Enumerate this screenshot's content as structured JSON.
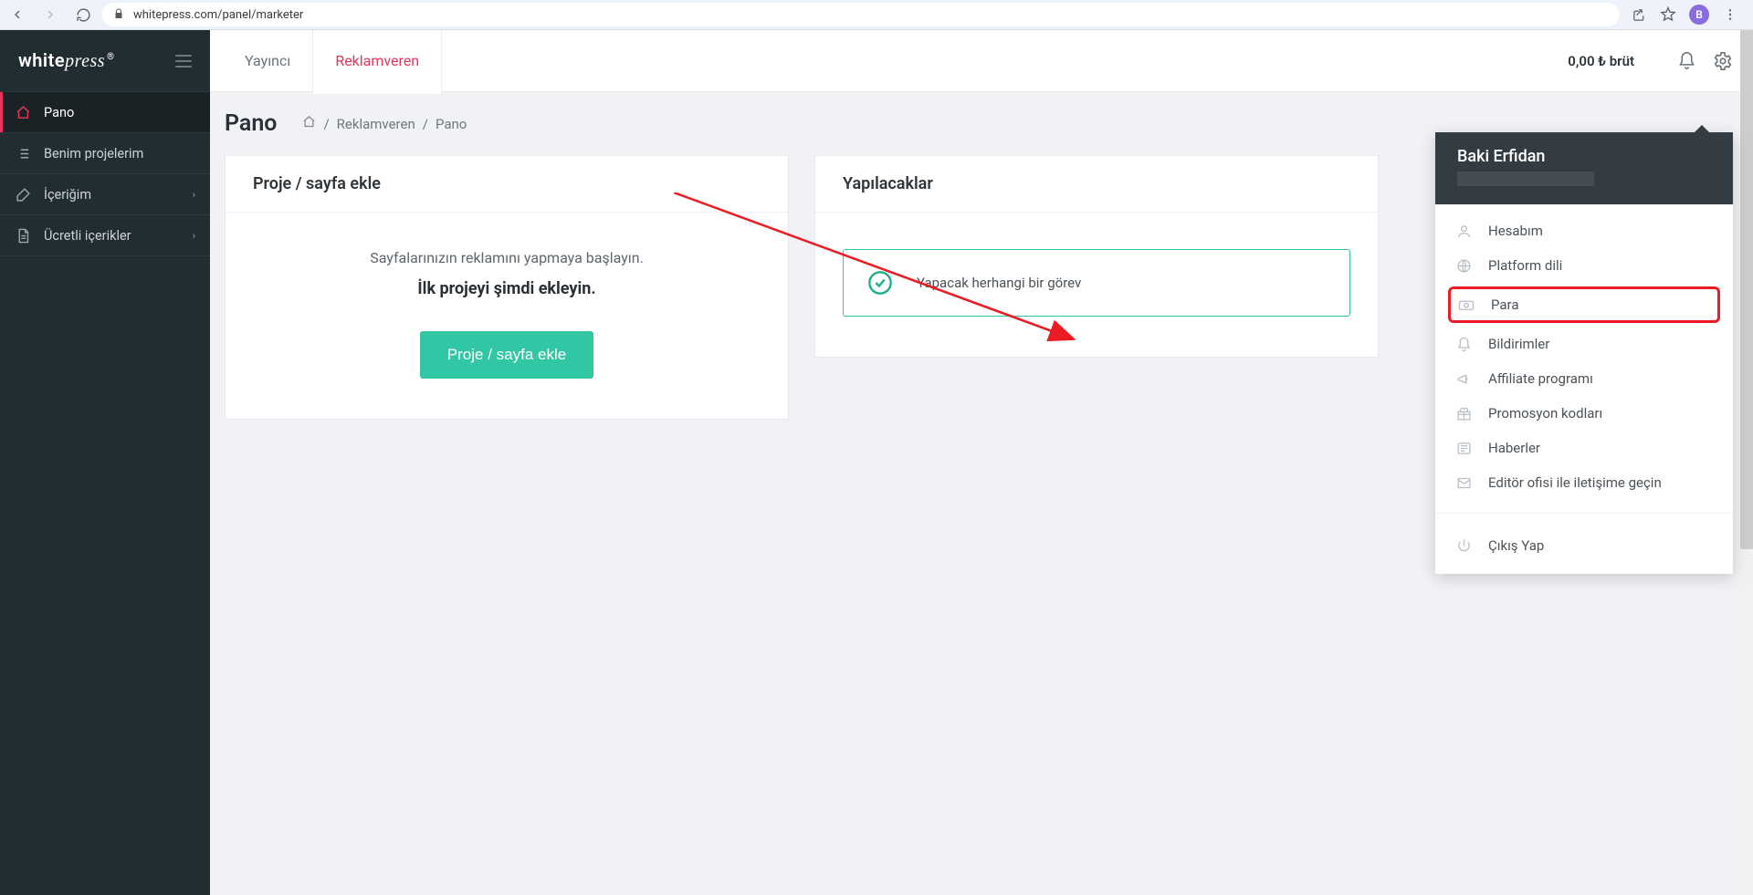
{
  "browser": {
    "url": "whitepress.com/panel/marketer",
    "avatar_initial": "B"
  },
  "sidebar": {
    "logo_white": "white",
    "logo_press": "press",
    "items": [
      {
        "label": "Pano",
        "icon": "home-icon",
        "active": true,
        "expandable": false
      },
      {
        "label": "Benim projelerim",
        "icon": "list-icon",
        "active": false,
        "expandable": false
      },
      {
        "label": "İçeriğim",
        "icon": "edit-icon",
        "active": false,
        "expandable": true
      },
      {
        "label": "Ücretli içerikler",
        "icon": "file-icon",
        "active": false,
        "expandable": true
      }
    ]
  },
  "topbar": {
    "tabs": [
      {
        "label": "Yayıncı",
        "active": false
      },
      {
        "label": "Reklamveren",
        "active": true
      }
    ],
    "balance": "0,00 ₺ brüt"
  },
  "page": {
    "title": "Pano",
    "crumbs": {
      "a": "Reklamveren",
      "sep": "/",
      "b": "Pano"
    }
  },
  "project_card": {
    "title": "Proje / sayfa ekle",
    "desc": "Sayfalarınızın reklamını yapmaya başlayın.",
    "bold": "İlk projeyi şimdi ekleyin.",
    "button": "Proje / sayfa ekle"
  },
  "todo_card": {
    "title": "Yapılacaklar",
    "ok_text": "Yapacak herhangi bir görev"
  },
  "dropdown": {
    "user": "Baki Erfidan",
    "items": [
      {
        "label": "Hesabım",
        "icon": "user-icon"
      },
      {
        "label": "Platform dili",
        "icon": "globe-icon"
      },
      {
        "label": "Para",
        "icon": "money-icon",
        "highlighted": true
      },
      {
        "label": "Bildirimler",
        "icon": "bell-icon"
      },
      {
        "label": "Affiliate programı",
        "icon": "megaphone-icon"
      },
      {
        "label": "Promosyon kodları",
        "icon": "gift-icon"
      },
      {
        "label": "Haberler",
        "icon": "news-icon"
      },
      {
        "label": "Editör ofisi ile iletişime geçin",
        "icon": "mail-icon"
      }
    ],
    "logout": "Çıkış Yap"
  }
}
